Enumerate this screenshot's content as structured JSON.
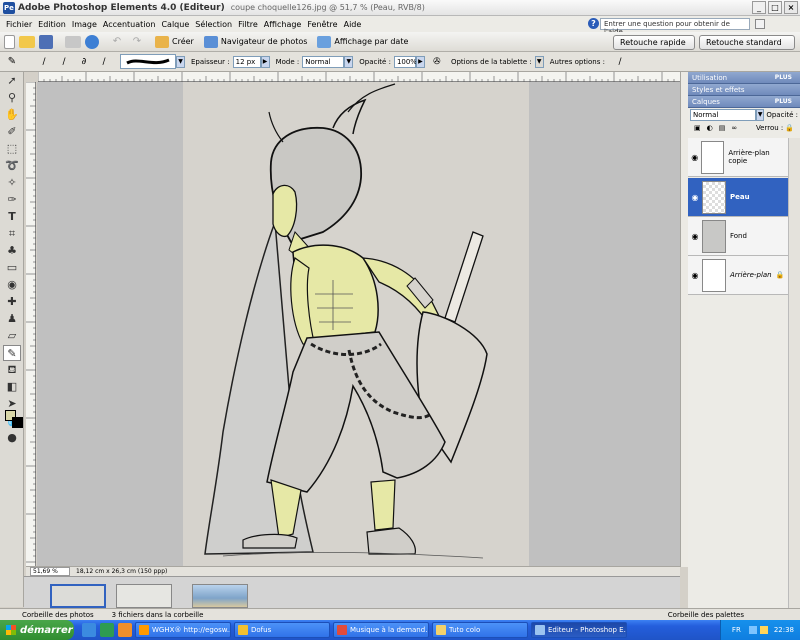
{
  "window": {
    "app_title": "Adobe Photoshop Elements 4.0 (Editeur)",
    "doc_title": "coupe choquelle126.jpg @ 51,7 % (Peau, RVB/8)",
    "min": "_",
    "max": "□",
    "close": "×"
  },
  "menu": [
    "Fichier",
    "Edition",
    "Image",
    "Accentuation",
    "Calque",
    "Sélection",
    "Filtre",
    "Affichage",
    "Fenêtre",
    "Aide"
  ],
  "help": {
    "icon": "?",
    "placeholder": "Entrer une question pour obtenir de l'aide"
  },
  "shortcuts": {
    "creer": "Créer",
    "navigateur": "Navigateur de photos",
    "affichage_date": "Affichage par date",
    "retouche_rapide": "Retouche rapide",
    "retouche_standard": "Retouche standard"
  },
  "options": {
    "epaisseur_label": "Epaisseur :",
    "epaisseur_value": "12 px",
    "mode_label": "Mode :",
    "mode_value": "Normal",
    "opacite_label": "Opacité :",
    "opacite_value": "100%",
    "tablette": "Options de la tablette :",
    "autres": "Autres options :"
  },
  "status": {
    "zoom": "51,69 %",
    "dims": "18,12 cm x 26,3 cm (150 ppp)"
  },
  "bin": {
    "corbeille_photos": "Corbeille des photos",
    "count": "3 fichiers dans la corbeille",
    "corbeille_palettes": "Corbeille des palettes"
  },
  "panels": {
    "utilisation": "Utilisation",
    "styles": "Styles et effets",
    "calques": "Calques",
    "plus": "PLUS",
    "blend_mode": "Normal",
    "opacite": "Opacité :",
    "verrou": "Verrou :"
  },
  "layers": [
    {
      "name": "Arrière-plan copie"
    },
    {
      "name": "Peau"
    },
    {
      "name": "Fond"
    },
    {
      "name": "Arrière-plan"
    }
  ],
  "taskbar": {
    "start": "démarrer",
    "tasks": [
      "WGHX® http://egosw...",
      "Dofus",
      "Musique à la demand...",
      "Tuto colo",
      "Editeur - Photoshop E..."
    ],
    "lang": "FR",
    "clock": "22:38"
  },
  "colors": {
    "accent": "#3162c0",
    "skin": "#e6e8a6",
    "paper": "#d6d3cd"
  }
}
